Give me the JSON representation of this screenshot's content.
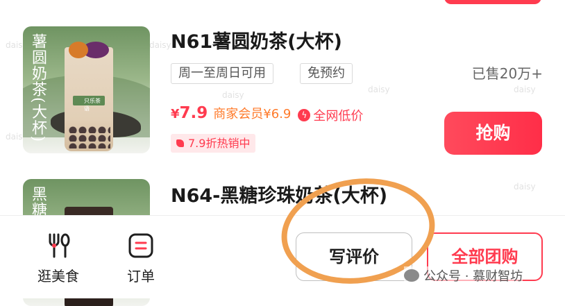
{
  "watermark": "daisy",
  "products": [
    {
      "image_caption": "薯圆奶茶(大杯)",
      "image_logo_text": "只乐茶语",
      "title": "N61薯圆奶茶(大杯)",
      "tags": [
        "周一至周日可用",
        "免预约"
      ],
      "sold": "已售20万+",
      "price_symbol": "¥",
      "price": "7.9",
      "member_price": "商家会员¥6.9",
      "lowest_label": "全网低价",
      "hot_badge": "7.9折热销中",
      "buy_label": "抢购"
    },
    {
      "image_caption": "黑糖珍",
      "title": "N64-黑糖珍珠奶茶(大杯)"
    }
  ],
  "bottom_bar": {
    "food_label": "逛美食",
    "orders_label": "订单",
    "review_label": "写评价",
    "all_group_label": "全部团购"
  },
  "footer_watermark": "公众号 · 慕财智坊",
  "colors": {
    "accent": "#ff3b4f",
    "member": "#ff7a2a",
    "annotation": "#f0a050"
  },
  "icons": {
    "food": "fork-spoon-icon",
    "orders": "order-list-icon",
    "lowest": "lightning-icon",
    "hot": "tag-icon"
  }
}
